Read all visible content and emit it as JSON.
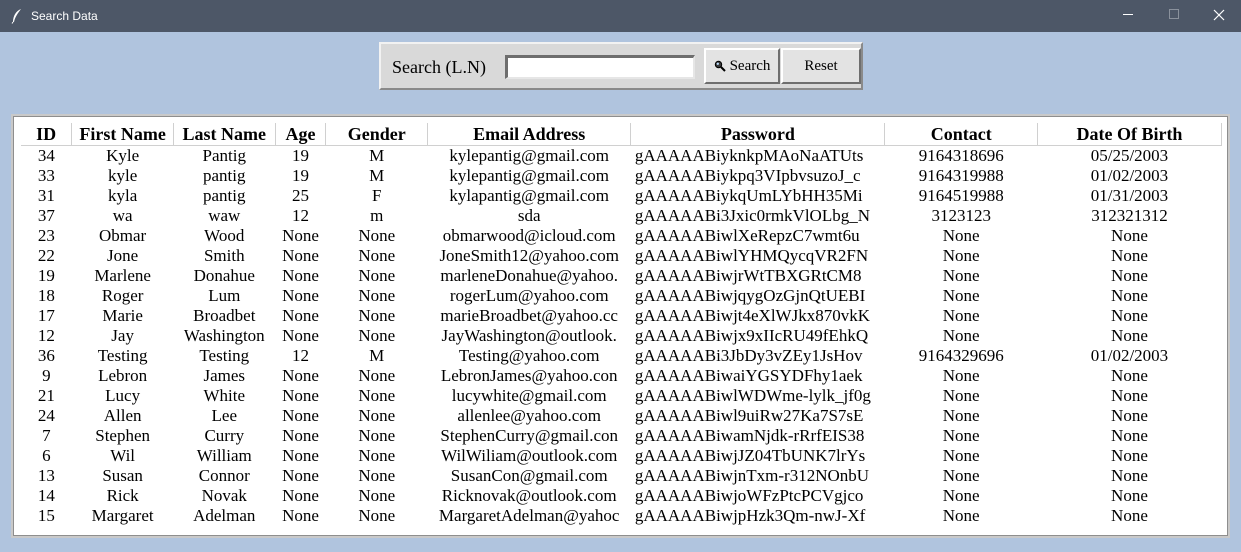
{
  "window": {
    "title": "Search Data",
    "icons": {
      "app": "feather-icon",
      "minimize": "minimize-icon",
      "maximize": "maximize-icon",
      "close": "close-icon"
    }
  },
  "search": {
    "label": "Search (L.N)",
    "value": "",
    "placeholder": "",
    "search_button": "Search",
    "reset_button": "Reset"
  },
  "table": {
    "headers": [
      "ID",
      "First Name",
      "Last Name",
      "Age",
      "Gender",
      "Email Address",
      "Password",
      "Contact",
      "Date Of Birth"
    ],
    "rows": [
      [
        "34",
        "Kyle",
        "Pantig",
        "19",
        "M",
        "kylepantig@gmail.com",
        "gAAAAABiyknkpMAoNaATUts",
        "9164318696",
        "05/25/2003"
      ],
      [
        "33",
        "kyle",
        "pantig",
        "19",
        "M",
        "kylepantig@gmail.com",
        "gAAAAABiykpq3VIpbvsuzoJ_c",
        "9164319988",
        "01/02/2003"
      ],
      [
        "31",
        "kyla",
        "pantig",
        "25",
        "F",
        "kylapantig@gmail.com",
        "gAAAAABiykqUmLYbHH35Mi",
        "9164519988",
        "01/31/2003"
      ],
      [
        "37",
        "wa",
        "waw",
        "12",
        "m",
        "sda",
        "gAAAAABi3Jxic0rmkVlOLbg_N",
        "3123123",
        "312321312"
      ],
      [
        "23",
        "Obmar",
        "Wood",
        "None",
        "None",
        "obmarwood@icloud.com",
        "gAAAAABiwlXeRepzC7wmt6u",
        "None",
        "None"
      ],
      [
        "22",
        "Jone",
        "Smith",
        "None",
        "None",
        "JoneSmith12@yahoo.com",
        "gAAAAABiwlYHMQycqVR2FN",
        "None",
        "None"
      ],
      [
        "19",
        "Marlene",
        "Donahue",
        "None",
        "None",
        "marleneDonahue@yahoo.",
        "gAAAAABiwjrWtTBXGRtCM8",
        "None",
        "None"
      ],
      [
        "18",
        "Roger",
        "Lum",
        "None",
        "None",
        "rogerLum@yahoo.com",
        "gAAAAABiwjqygOzGjnQtUEBI",
        "None",
        "None"
      ],
      [
        "17",
        "Marie",
        "Broadbet",
        "None",
        "None",
        "marieBroadbet@yahoo.cc",
        "gAAAAABiwjt4eXlWJkx870vkK",
        "None",
        "None"
      ],
      [
        "12",
        "Jay",
        "Washington",
        "None",
        "None",
        "JayWashington@outlook.",
        "gAAAAABiwjx9xIIcRU49fEhkQ",
        "None",
        "None"
      ],
      [
        "36",
        "Testing",
        "Testing",
        "12",
        "M",
        "Testing@yahoo.com",
        "gAAAAABi3JbDy3vZEy1JsHov",
        "9164329696",
        "01/02/2003"
      ],
      [
        "9",
        "Lebron",
        "James",
        "None",
        "None",
        "LebronJames@yahoo.con",
        "gAAAAABiwaiYGSYDFhy1aek",
        "None",
        "None"
      ],
      [
        "21",
        "Lucy",
        "White",
        "None",
        "None",
        "lucywhite@gmail.com",
        "gAAAAABiwlWDWme-lylk_jf0g",
        "None",
        "None"
      ],
      [
        "24",
        "Allen",
        "Lee",
        "None",
        "None",
        "allenlee@yahoo.com",
        "gAAAAABiwl9uiRw27Ka7S7sE",
        "None",
        "None"
      ],
      [
        "7",
        "Stephen",
        "Curry",
        "None",
        "None",
        "StephenCurry@gmail.con",
        "gAAAAABiwamNjdk-rRrfEIS38",
        "None",
        "None"
      ],
      [
        "6",
        "Wil",
        "William",
        "None",
        "None",
        "WilWiliam@outlook.com",
        "gAAAAABiwjJZ04TbUNK7lrYs",
        "None",
        "None"
      ],
      [
        "13",
        "Susan",
        "Connor",
        "None",
        "None",
        "SusanCon@gmail.com",
        "gAAAAABiwjnTxm-r312NOnbU",
        "None",
        "None"
      ],
      [
        "14",
        "Rick",
        "Novak",
        "None",
        "None",
        "Ricknovak@outlook.com",
        "gAAAAABiwjoWFzPtcPCVgjco",
        "None",
        "None"
      ],
      [
        "15",
        "Margaret",
        "Adelman",
        "None",
        "None",
        "MargaretAdelman@yahoc",
        "gAAAAABiwjpHzk3Qm-nwJ-Xf",
        "None",
        "None"
      ]
    ]
  }
}
